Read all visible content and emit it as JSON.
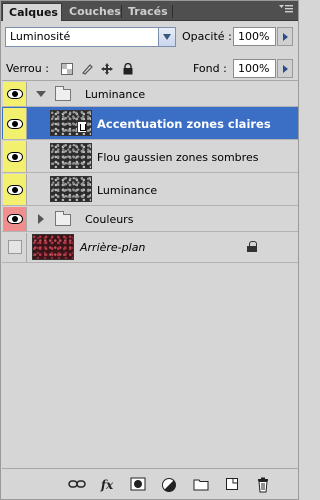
{
  "tabs": [
    {
      "label": "Calques",
      "active": true
    },
    {
      "label": "Couches",
      "active": false
    },
    {
      "label": "Tracés",
      "active": false
    }
  ],
  "panel_menu_icon": "panel-menu-icon",
  "blend_mode": {
    "value": "Luminosité"
  },
  "opacity": {
    "label": "Opacité :",
    "value": "100%"
  },
  "lock": {
    "label": "Verrou :"
  },
  "fill": {
    "label": "Fond :",
    "value": "100%"
  },
  "layers": [
    {
      "name": "Luminance",
      "type": "group",
      "expanded": true,
      "visible": true,
      "color": "yellow"
    },
    {
      "name": "Accentuation zones claires",
      "type": "layer",
      "selected": true,
      "visible": true,
      "color": "yellow",
      "has_mask_link": true
    },
    {
      "name": "Flou gaussien zones sombres",
      "type": "layer",
      "visible": true,
      "color": "yellow"
    },
    {
      "name": "Luminance",
      "type": "layer",
      "visible": true,
      "color": "yellow"
    },
    {
      "name": "Couleurs",
      "type": "group",
      "expanded": false,
      "visible": true,
      "color": "red"
    },
    {
      "name": "Arrière-plan",
      "type": "background",
      "visible": false,
      "locked": true
    }
  ],
  "colors": {
    "selected": "#3b6fc5",
    "yellow_label": "#f2f06e",
    "red_label": "#f08e8e",
    "tabbar": "#4f4f4f"
  },
  "toolbar_icons": [
    "link-icon",
    "fx-icon",
    "mask-icon",
    "adjustment-icon",
    "new-group-icon",
    "new-layer-icon",
    "trash-icon"
  ],
  "toolbar_fx_label": "fx"
}
